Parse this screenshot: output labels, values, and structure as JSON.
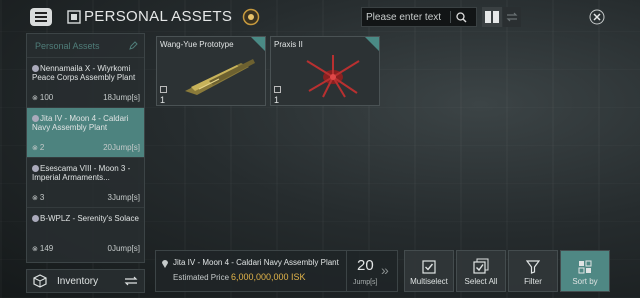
{
  "header": {
    "title": "PERSONAL ASSETS"
  },
  "search": {
    "placeholder": "Please enter text"
  },
  "sidebar": {
    "heading": "Personal Assets",
    "locations": [
      {
        "name": "Nennamaila X - Wiyrkomi Peace Corps Assembly Plant",
        "count": "100",
        "jumps": "18Jump[s]",
        "selected": false
      },
      {
        "name": "Jita IV - Moon 4 - Caldari Navy Assembly Plant",
        "count": "2",
        "jumps": "20Jump[s]",
        "selected": true
      },
      {
        "name": "Esescama VIII - Moon 3 - Imperial Armaments...",
        "count": "3",
        "jumps": "3Jump[s]",
        "selected": false
      },
      {
        "name": "B-WPLZ - Serenity's Solace",
        "count": "149",
        "jumps": "0Jump[s]",
        "selected": false
      }
    ],
    "inventory_label": "Inventory"
  },
  "items": [
    {
      "name": "Wang-Yue Prototype",
      "quantity": "1",
      "icon": "frigate-ship-icon"
    },
    {
      "name": "Praxis II",
      "quantity": "1",
      "icon": "spider-ship-icon"
    }
  ],
  "footer": {
    "location": "Jita IV - Moon 4 - Caldari Navy Assembly Plant",
    "price_label": "Estimated Price",
    "price_value": "6,000,000,000 ISK",
    "jumps_value": "20",
    "jumps_unit": "Jump[s]",
    "buttons": {
      "multiselect": "Multiselect",
      "select_all": "Select All",
      "filter": "Filter",
      "sort_by": "Sort by"
    }
  },
  "colors": {
    "accent": "#4f8884",
    "price": "#e2b44a",
    "sidebar_heading": "#4f7d79"
  }
}
